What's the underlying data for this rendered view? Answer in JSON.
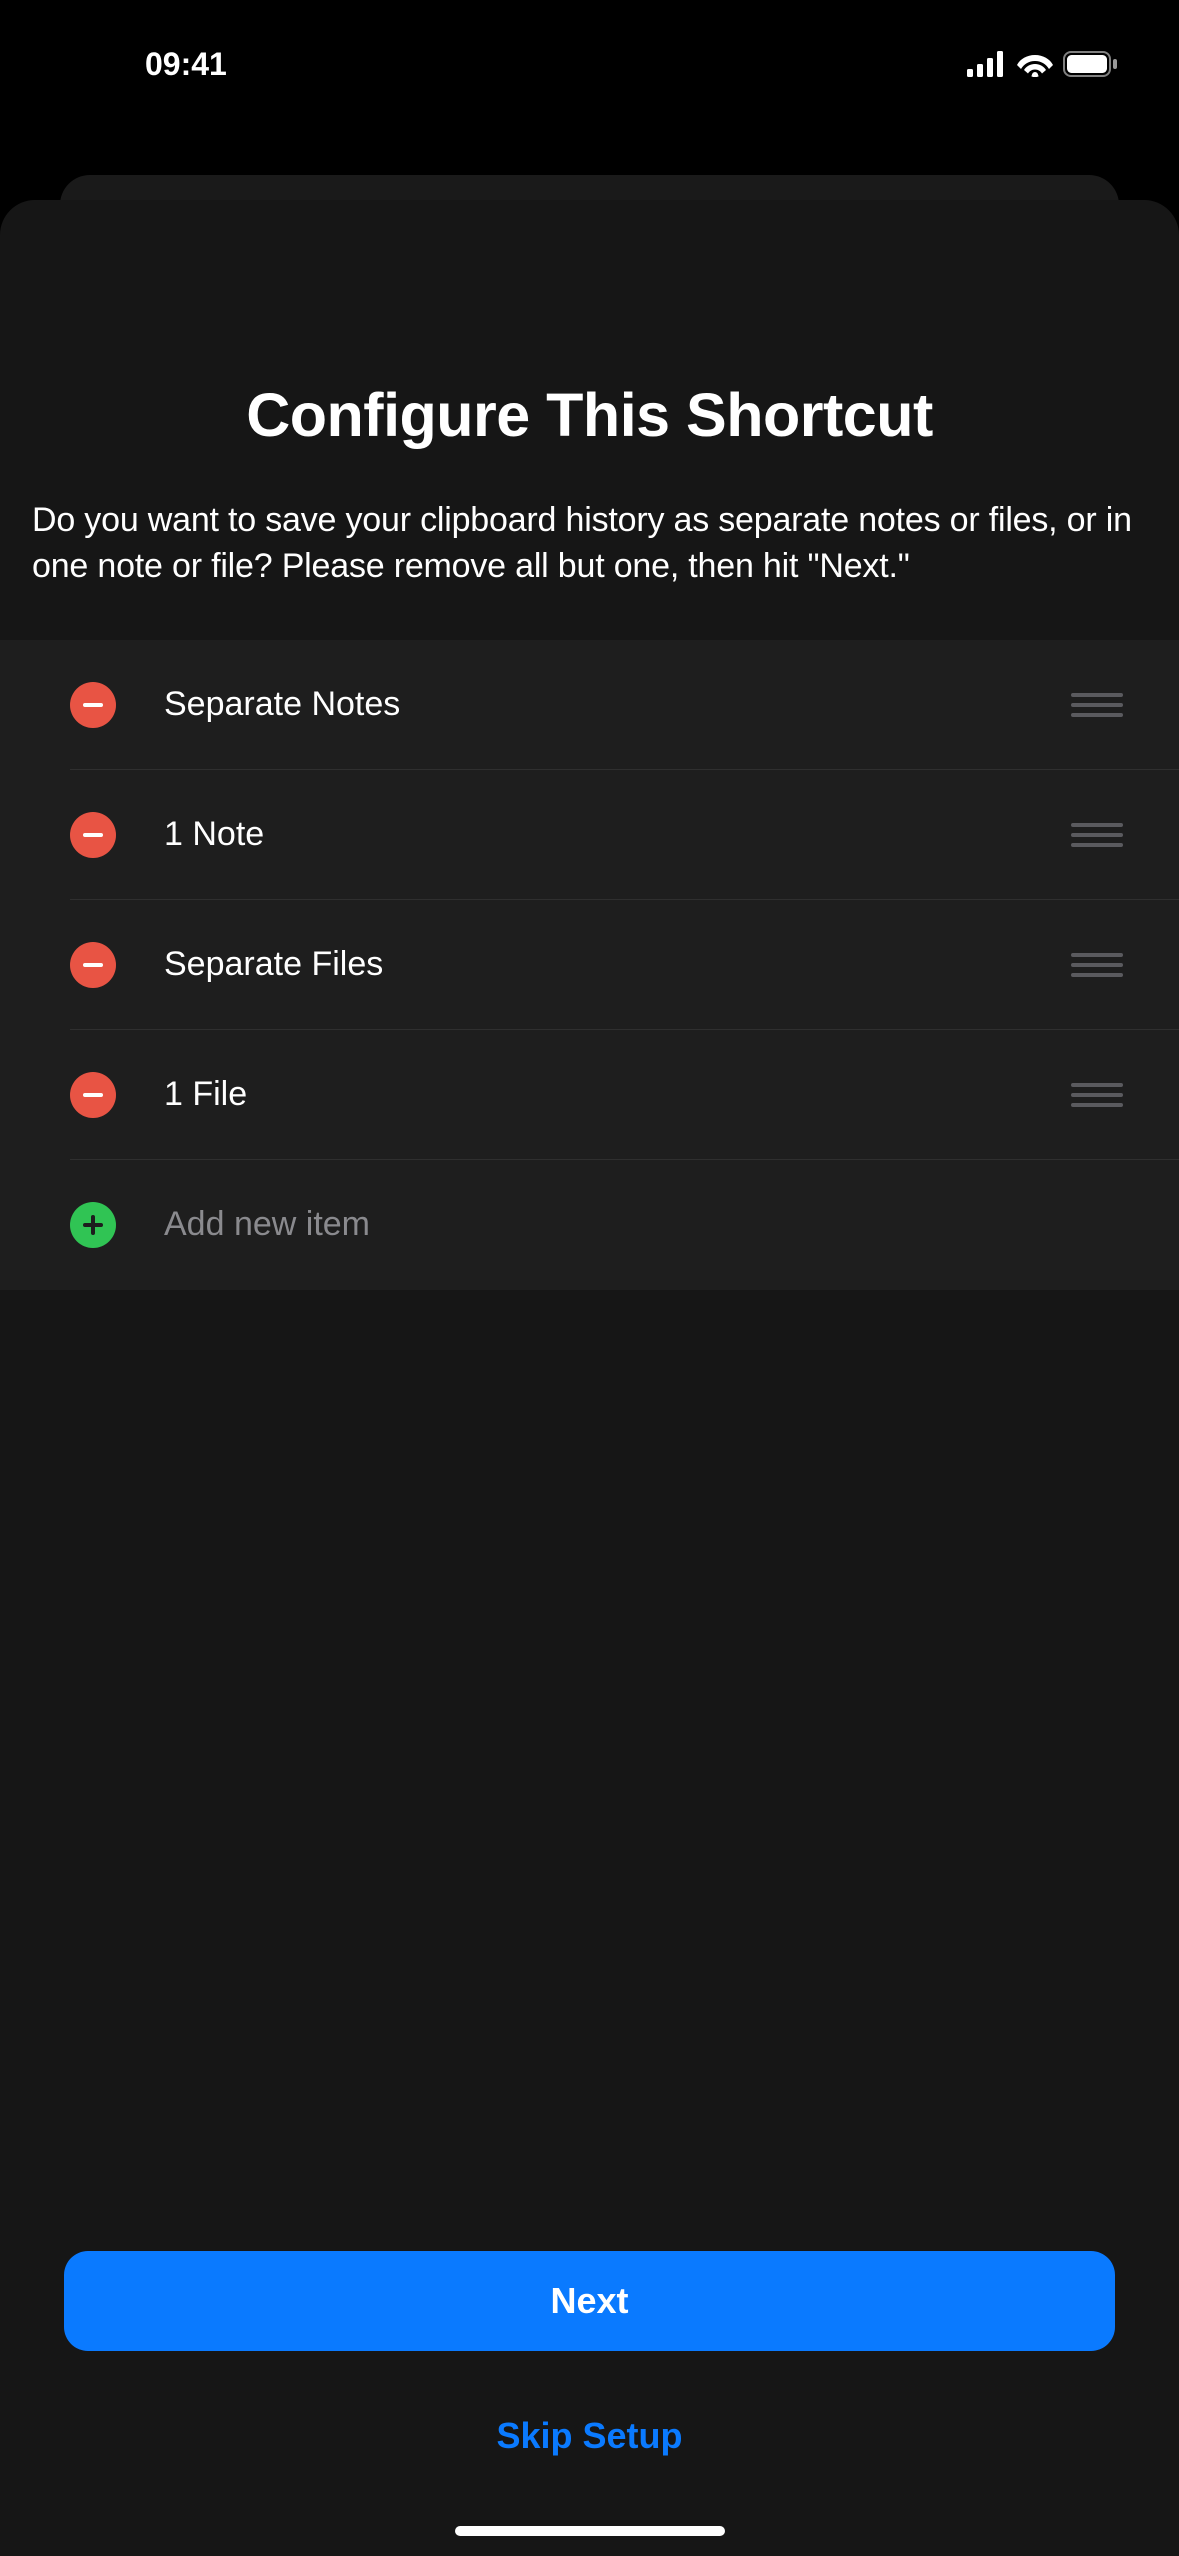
{
  "status_bar": {
    "time": "09:41"
  },
  "sheet": {
    "title": "Configure This Shortcut",
    "description": "Do you want to save your clipboard history as separate notes or files, or in one note or file? Please remove all but one, then hit \"Next.\""
  },
  "list": {
    "items": [
      {
        "label": "Separate Notes"
      },
      {
        "label": "1 Note"
      },
      {
        "label": "Separate Files"
      },
      {
        "label": "1 File"
      }
    ],
    "add_label": "Add new item"
  },
  "footer": {
    "primary": "Next",
    "secondary": "Skip Setup"
  }
}
